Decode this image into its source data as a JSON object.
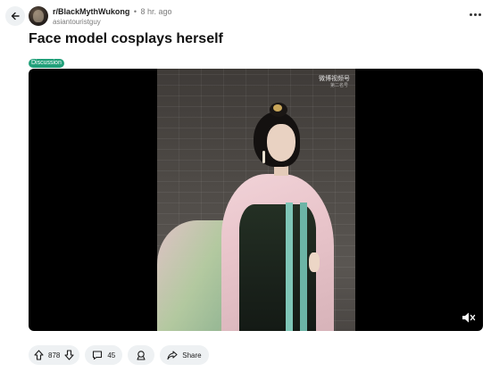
{
  "header": {
    "subreddit": "r/BlackMythWukong",
    "separator": "•",
    "time_ago": "8 hr. ago",
    "author": "asiantouristguy"
  },
  "post": {
    "title": "Face model cosplays herself",
    "flair": "Discussion"
  },
  "video": {
    "watermark": "微博视频号",
    "watermark_sub": "第二名号"
  },
  "actions": {
    "upvotes": "878",
    "comments": "45",
    "share_label": "Share"
  },
  "icons": {
    "back": "back-arrow-icon",
    "more": "more-options-icon",
    "upvote": "upvote-arrow-icon",
    "downvote": "downvote-arrow-icon",
    "comment": "comment-bubble-icon",
    "award": "award-icon",
    "share": "share-arrow-icon",
    "mute": "muted-speaker-icon"
  },
  "colors": {
    "flair_bg": "#22a07a",
    "pill_bg": "#eef1f3"
  }
}
